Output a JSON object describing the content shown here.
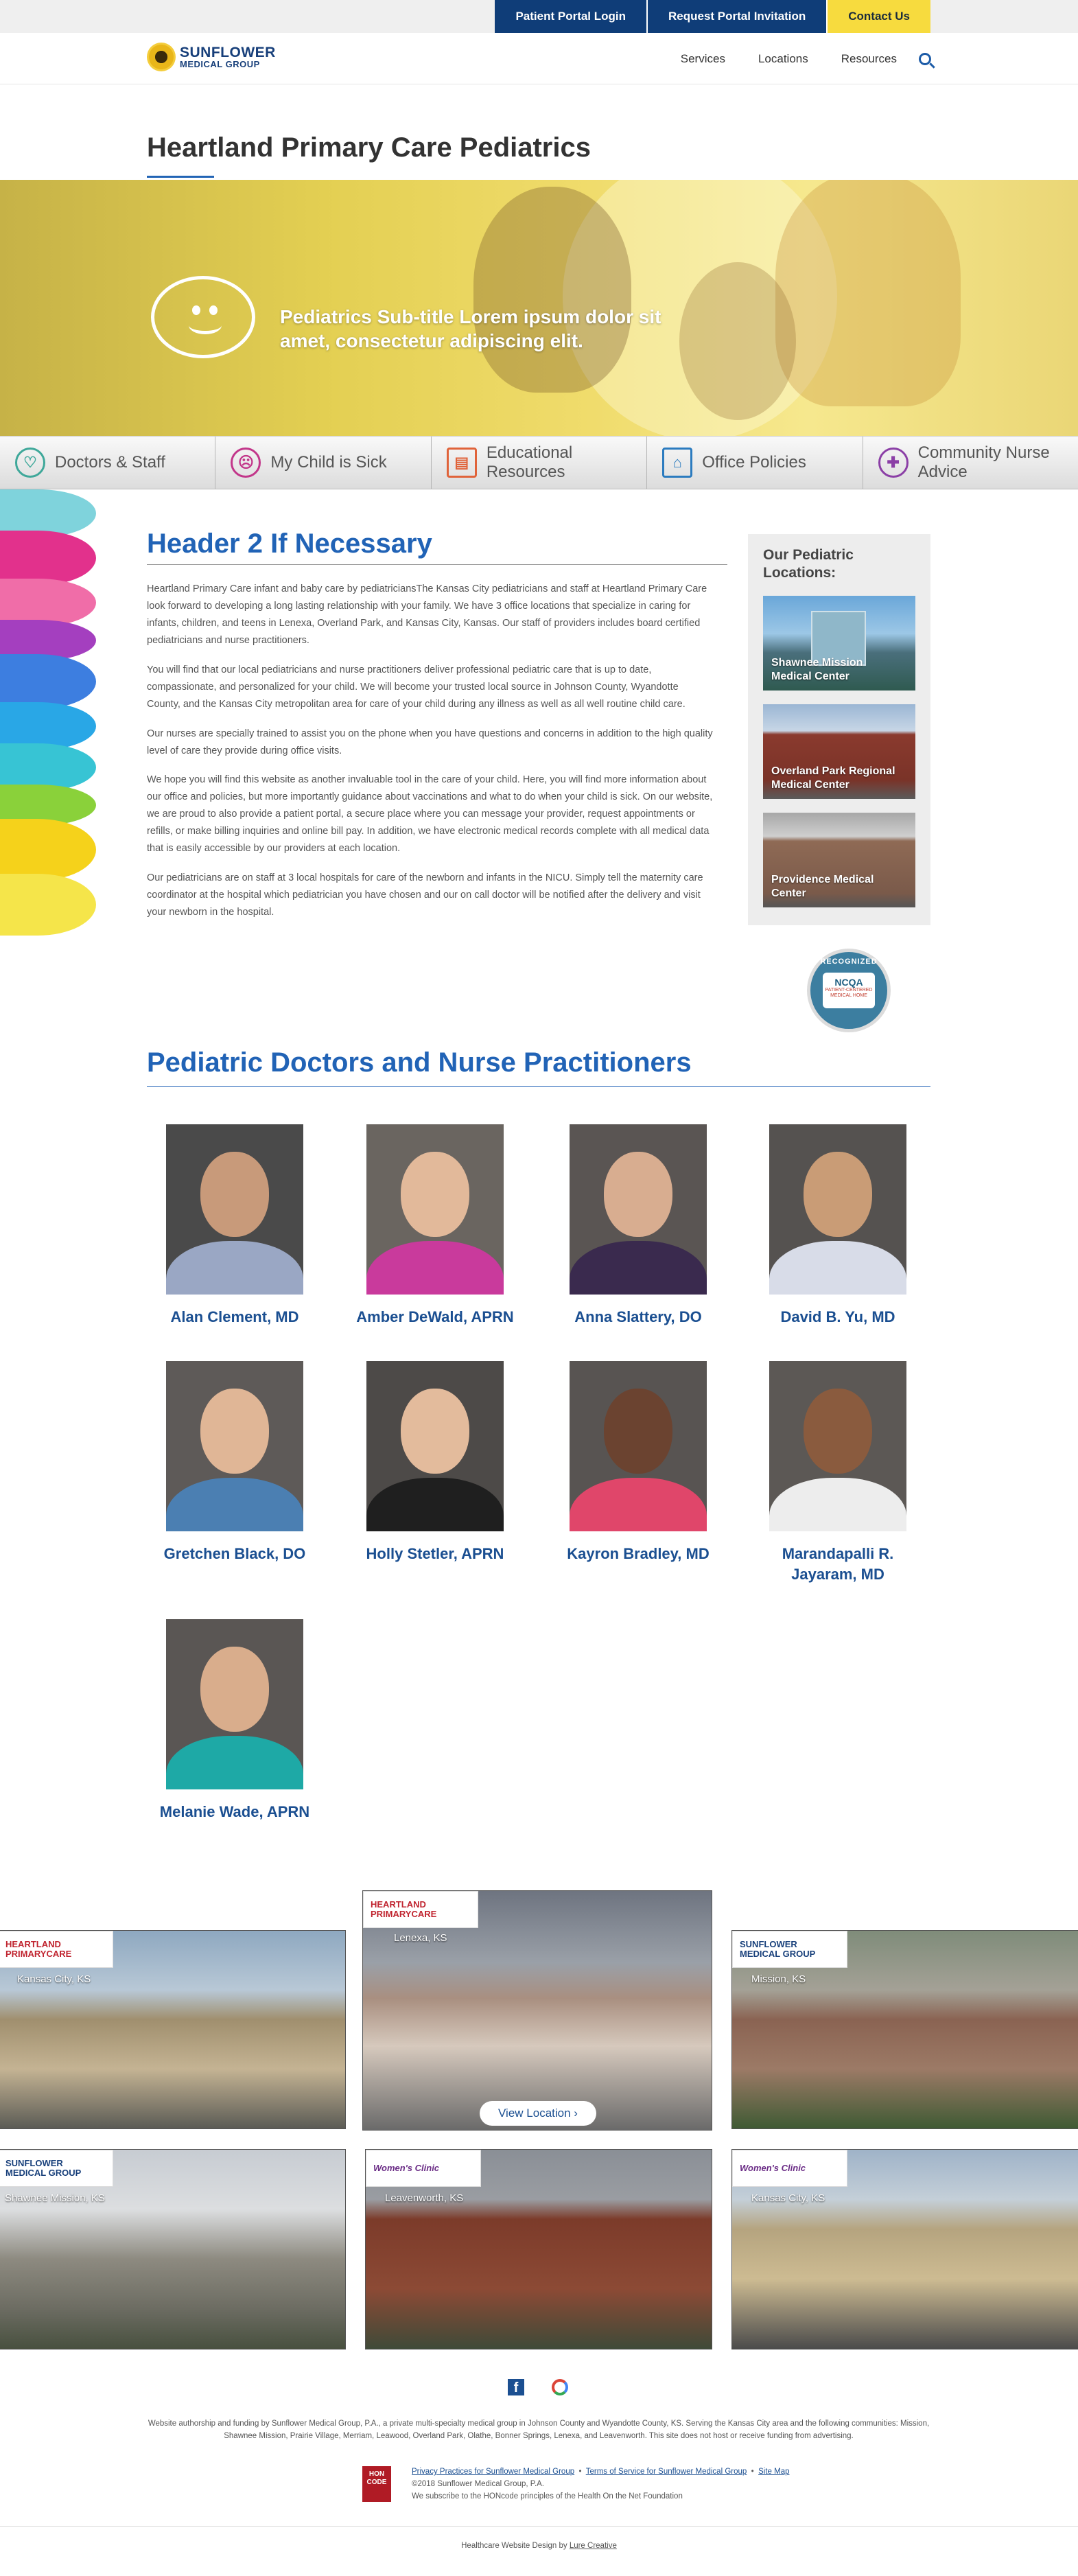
{
  "topbar": {
    "patient_portal": "Patient Portal Login",
    "request_invitation": "Request Portal Invitation",
    "contact": "Contact Us"
  },
  "brand": {
    "line1": "SUNFLOWER",
    "line2": "MEDICAL GROUP"
  },
  "nav": {
    "services": "Services",
    "locations": "Locations",
    "resources": "Resources"
  },
  "page_title": "Heartland Primary Care Pediatrics",
  "hero": {
    "subtitle": "Pediatrics Sub-title Lorem ipsum dolor sit amet, consectetur adipiscing elit."
  },
  "quick_links": [
    {
      "label": "Doctors & Staff",
      "icon": "stethoscope-icon",
      "color": "#3fa89a"
    },
    {
      "label": "My Child is Sick",
      "icon": "sick-child-icon",
      "color": "#c2368a"
    },
    {
      "label": "Educational Resources",
      "icon": "book-icon",
      "color": "#e0633a"
    },
    {
      "label": "Office Policies",
      "icon": "building-icon",
      "color": "#2b7bbf"
    },
    {
      "label": "Community Nurse Advice",
      "icon": "nurse-icon",
      "color": "#8b3fa6"
    }
  ],
  "main": {
    "header2": "Header 2 If Necessary",
    "paragraphs": [
      "Heartland Primary Care infant and baby care by pediatriciansThe Kansas City pediatricians and staff at Heartland Primary Care look forward to developing a long lasting relationship with your family. We have 3 office locations that specialize in caring for infants, children, and teens in Lenexa, Overland Park, and Kansas City, Kansas. Our staff of providers includes board certified pediatricians and nurse practitioners.",
      "You will find that our local pediatricians and nurse practitioners deliver professional pediatric care that is up to date, compassionate, and personalized for your child. We will become your trusted local source in Johnson County, Wyandotte County, and the Kansas City metropolitan area for care of your child during any illness as well as all well routine child care.",
      "Our nurses are specially trained to assist you on the phone when you have questions and concerns in addition to the high quality level of care they provide during office visits.",
      "We hope you will find this website as another invaluable tool in the care of your child. Here, you will find more information about our office and policies, but more importantly guidance about vaccinations and what to do when your child is sick. On our website, we are proud to also provide a patient portal, a secure place where you can message your provider, request appointments or refills, or make billing inquiries and online bill pay. In addition, we have electronic medical records complete with all medical data that is easily accessible by our providers at each location.",
      "Our pediatricians are on staff at 3 local hospitals for care of the newborn and infants in the NICU. Simply tell the maternity care coordinator at the hospital which pediatrician you have chosen and our on call doctor will be notified after the delivery and visit your newborn in the hospital."
    ]
  },
  "locations_box": {
    "title": "Our Pediatric Locations:",
    "items": [
      {
        "label": "Shawnee Mission Medical Center"
      },
      {
        "label": "Overland Park Regional Medical Center"
      },
      {
        "label": "Providence Medical Center"
      }
    ]
  },
  "ncqa": {
    "recognized": "RECOGNIZED",
    "name": "NCQA",
    "sub": "PATIENT-CENTERED MEDICAL HOME"
  },
  "doctors": {
    "header": "Pediatric Doctors and Nurse Practitioners",
    "list": [
      {
        "name": "Alan Clement, MD",
        "bg": "#4a4a4a",
        "skin": "#c89a7a",
        "shirt": "#9aa7c4"
      },
      {
        "name": "Amber DeWald, APRN",
        "bg": "#6a6560",
        "skin": "#e2b99a",
        "shirt": "#c93a9c"
      },
      {
        "name": "Anna Slattery, DO",
        "bg": "#5a5553",
        "skin": "#d8ad90",
        "shirt": "#3a2a4e"
      },
      {
        "name": "David B. Yu, MD",
        "bg": "#555250",
        "skin": "#c99c76",
        "shirt": "#d8dce8"
      },
      {
        "name": "Gretchen Black, DO",
        "bg": "#5e5a58",
        "skin": "#e0b696",
        "shirt": "#4b7fb2"
      },
      {
        "name": "Holly Stetler, APRN",
        "bg": "#4d4a48",
        "skin": "#e3bb9c",
        "shirt": "#1f1f1f"
      },
      {
        "name": "Kayron Bradley, MD",
        "bg": "#585452",
        "skin": "#6b4330",
        "shirt": "#e0466a"
      },
      {
        "name": "Marandapalli R. Jayaram, MD",
        "bg": "#5c5855",
        "skin": "#8a5b3e",
        "shirt": "#ededed"
      },
      {
        "name": "Melanie Wade, APRN",
        "bg": "#5a5654",
        "skin": "#d9ad8c",
        "shirt": "#1ea9a6"
      }
    ]
  },
  "location_tiles": [
    {
      "city": "Kansas City, KS",
      "brand": "HEARTLAND PRIMARYCARE",
      "brand_color": "#c0242f"
    },
    {
      "city": "Lenexa, KS",
      "brand": "HEARTLAND PRIMARYCARE",
      "brand_color": "#c0242f",
      "button": "View Location"
    },
    {
      "city": "Mission, KS",
      "brand": "SUNFLOWER MEDICAL GROUP",
      "brand_color": "#173f7a"
    },
    {
      "city": "Shawnee Mission, KS",
      "brand": "SUNFLOWER MEDICAL GROUP",
      "brand_color": "#173f7a"
    },
    {
      "city": "Leavenworth, KS",
      "brand": "Women's Clinic",
      "brand_color": "#6b2d86"
    },
    {
      "city": "Kansas City, KS",
      "brand": "Women's Clinic",
      "brand_color": "#6b2d86"
    }
  ],
  "footer": {
    "facebook": "f",
    "disclaimer": "Website authorship and funding by Sunflower Medical Group, P.A., a private multi-specialty medical group in Johnson County and Wyandotte County, KS. Serving the Kansas City area and the following communities: Mission, Shawnee Mission, Prairie Village, Merriam, Leawood, Overland Park, Olathe, Bonner Springs, Lenexa, and Leavenworth. This site does not host or receive funding from advertising.",
    "privacy": "Privacy Practices for Sunflower Medical Group",
    "terms": "Terms of Service for Sunflower Medical Group",
    "sitemap": "Site Map",
    "copyright": "©2018 Sunflower Medical Group, P.A.",
    "hon": "We subscribe to the HONcode principles of the Health On the Net Foundation",
    "hon_badge": "HON CODE",
    "credit_prefix": "Healthcare Website Design by",
    "credit_link": "Lure Creative"
  }
}
